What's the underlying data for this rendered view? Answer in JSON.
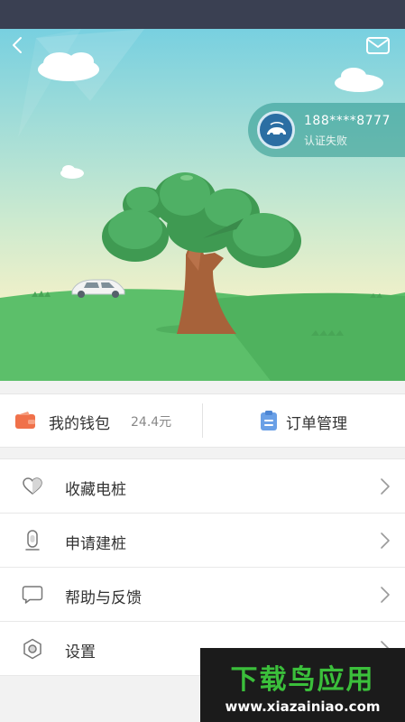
{
  "header": {
    "back_icon": "chevron-left-icon",
    "mail_icon": "mail-icon"
  },
  "user": {
    "phone": "188****8777",
    "status": "认证失败"
  },
  "quick_actions": {
    "wallet_label": "我的钱包",
    "wallet_balance": "24.4元",
    "orders_label": "订单管理"
  },
  "menu": {
    "items": [
      {
        "label": "收藏电桩",
        "icon": "heart-icon"
      },
      {
        "label": "申请建桩",
        "icon": "charger-icon"
      },
      {
        "label": "帮助与反馈",
        "icon": "chat-bubble-icon"
      },
      {
        "label": "设置",
        "icon": "gear-icon"
      }
    ]
  },
  "watermark": {
    "title": "下载鸟应用",
    "url": "www.xiazainiao.com"
  },
  "colors": {
    "status_bar": "#3a4052",
    "accent_orange": "#f0714a",
    "accent_blue": "#6aa0e6",
    "grass": "#5cbf6a",
    "watermark_green": "#3bbf3b"
  }
}
